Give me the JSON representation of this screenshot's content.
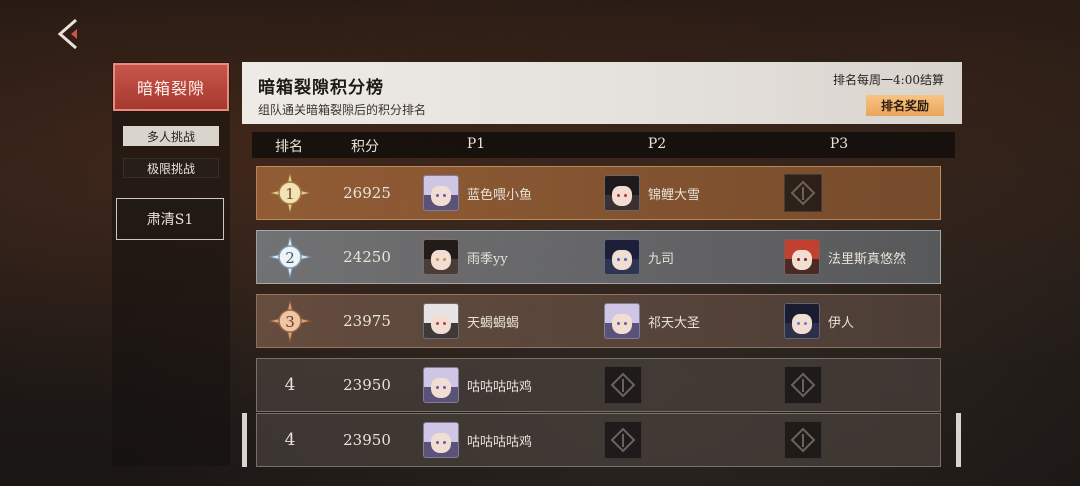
{
  "nav": {
    "back_icon": "back-arrow-icon"
  },
  "sidebar": {
    "category_label": "暗箱裂隙",
    "tabs": [
      {
        "label": "多人挑战",
        "active": true
      },
      {
        "label": "极限挑战",
        "active": false
      }
    ],
    "season_label": "肃清S1"
  },
  "board": {
    "title": "暗箱裂隙积分榜",
    "subtitle": "组队通关暗箱裂隙后的积分排名",
    "reset_note": "排名每周一4:00结算",
    "reward_button": "排名奖励"
  },
  "columns": {
    "rank": "排名",
    "score": "积分",
    "p1": "P1",
    "p2": "P2",
    "p3": "P3"
  },
  "rows": [
    {
      "rank": "1",
      "score": "26925",
      "p1": "蓝色喂小鱼",
      "p2": "锦鲤大雪",
      "p3": ""
    },
    {
      "rank": "2",
      "score": "24250",
      "p1": "雨季yy",
      "p2": "九司",
      "p3": "法里斯真悠然"
    },
    {
      "rank": "3",
      "score": "23975",
      "p1": "天蝎蝎蝎",
      "p2": "祁天大圣",
      "p3": "伊人"
    },
    {
      "rank": "4",
      "score": "23950",
      "p1": "咕咕咕咕鸡",
      "p2": "",
      "p3": ""
    },
    {
      "rank": "4",
      "score": "23950",
      "p1": "咕咕咕咕鸡",
      "p2": "",
      "p3": ""
    }
  ],
  "colors": {
    "accent_red": "#c9554a",
    "gold_row": "#965f37",
    "silver_row": "#787a7d",
    "bronze_row": "#695041",
    "reward_orange": "#eca55b"
  }
}
